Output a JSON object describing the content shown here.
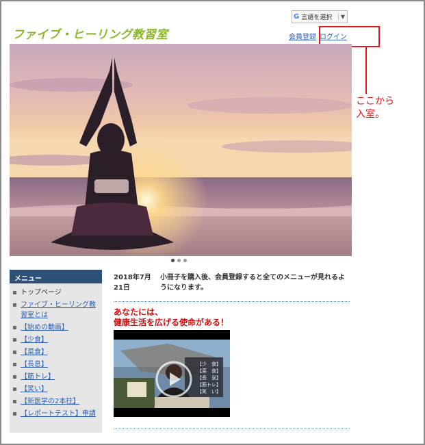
{
  "site": {
    "title": "ファイブ・ヒーリング教習室"
  },
  "translate": {
    "label": "言語を選択",
    "logo": "G",
    "arrow": "▼"
  },
  "auth": {
    "register": "会員登録",
    "login": "ログイン"
  },
  "callout": {
    "line1": "ここから",
    "line2": "入室。"
  },
  "slider": {
    "slides": 3,
    "active_index": 0
  },
  "menu": {
    "title": "メニュー",
    "items": [
      {
        "label": "トップページ"
      },
      {
        "label": "ファイブ・ヒーリング教習室とは"
      },
      {
        "label": "【始めの動画】"
      },
      {
        "label": "【少食】"
      },
      {
        "label": "【菜食】"
      },
      {
        "label": "【長息】"
      },
      {
        "label": "【筋トレ】"
      },
      {
        "label": "【笑い】"
      },
      {
        "label": "【新医学の2本柱】"
      },
      {
        "label": "【レポートテスト】申請"
      }
    ]
  },
  "news": {
    "date": "2018年7月21日",
    "text": "小冊子を購入後、会員登録すると全てのメニューが見れるようになります。"
  },
  "feature": {
    "line1": "あなたには、",
    "line2": "健康生活を広げる使命がある！",
    "video_items": [
      "【少　食】",
      "【菜　食】",
      "【長　息】",
      "【筋トレ】",
      "【笑　い】"
    ]
  },
  "colors": {
    "brand_green": "#8cb82a",
    "menu_header": "#2d4f78",
    "link": "#2a5db0",
    "accent_red": "#e2171d"
  }
}
